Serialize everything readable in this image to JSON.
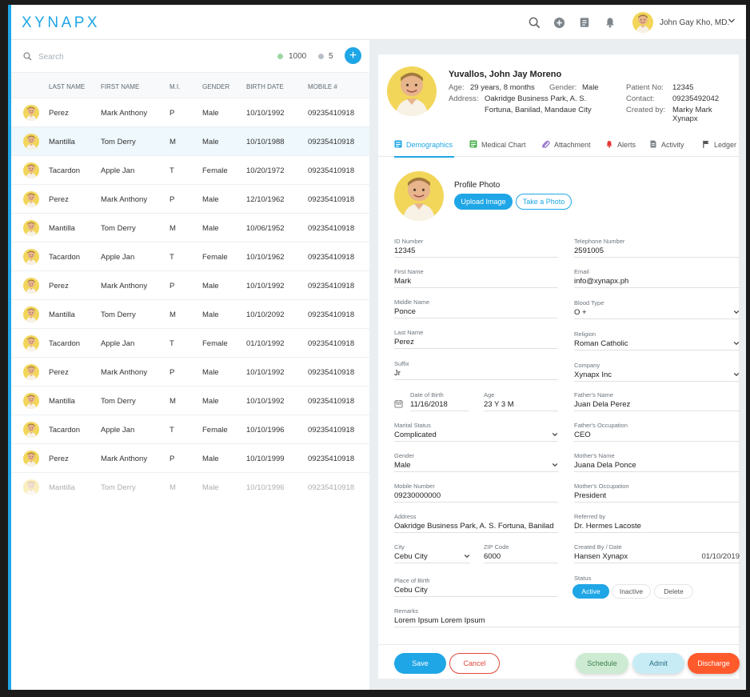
{
  "brand": {
    "logo": "XYNAPX",
    "accent_color": "#1fa6e6"
  },
  "topbar": {
    "icons": [
      "search-icon",
      "add-circle-icon",
      "notes-icon",
      "bell-icon"
    ],
    "user_name": "John Gay Kho, MD."
  },
  "patient_list": {
    "search_placeholder": "Search",
    "counts": [
      {
        "value": "1000",
        "color": "#9bd6a4"
      },
      {
        "value": "5",
        "color": "#b9c0c6"
      }
    ],
    "add_label": "+",
    "columns": [
      "LAST NAME",
      "FIRST NAME",
      "M.I.",
      "GENDER",
      "BIRTH DATE",
      "MOBILE #"
    ],
    "rows": [
      {
        "last": "Perez",
        "first": "Mark Anthony",
        "mi": "P",
        "gender": "Male",
        "birth": "10/10/1992",
        "mobile": "09235410918"
      },
      {
        "last": "Mantilla",
        "first": "Tom Derry",
        "mi": "M",
        "gender": "Male",
        "birth": "10/10/1988",
        "mobile": "09235410918",
        "selected": true
      },
      {
        "last": "Tacardon",
        "first": "Apple Jan",
        "mi": "T",
        "gender": "Female",
        "birth": "10/20/1972",
        "mobile": "09235410918"
      },
      {
        "last": "Perez",
        "first": "Mark Anthony",
        "mi": "P",
        "gender": "Male",
        "birth": "12/10/1962",
        "mobile": "09235410918"
      },
      {
        "last": "Mantilla",
        "first": "Tom Derry",
        "mi": "M",
        "gender": "Male",
        "birth": "10/06/1952",
        "mobile": "09235410918"
      },
      {
        "last": "Tacardon",
        "first": "Apple Jan",
        "mi": "T",
        "gender": "Female",
        "birth": "10/10/1962",
        "mobile": "09235410918"
      },
      {
        "last": "Perez",
        "first": "Mark Anthony",
        "mi": "P",
        "gender": "Male",
        "birth": "10/10/1992",
        "mobile": "09235410918"
      },
      {
        "last": "Mantilla",
        "first": "Tom Derry",
        "mi": "M",
        "gender": "Male",
        "birth": "10/10/2092",
        "mobile": "09235410918"
      },
      {
        "last": "Tacardon",
        "first": "Apple Jan",
        "mi": "T",
        "gender": "Female",
        "birth": "01/10/1992",
        "mobile": "09235410918"
      },
      {
        "last": "Perez",
        "first": "Mark Anthony",
        "mi": "P",
        "gender": "Male",
        "birth": "10/10/1992",
        "mobile": "09235410918"
      },
      {
        "last": "Mantilla",
        "first": "Tom Derry",
        "mi": "M",
        "gender": "Male",
        "birth": "10/10/1992",
        "mobile": "09235410918"
      },
      {
        "last": "Tacardon",
        "first": "Apple Jan",
        "mi": "T",
        "gender": "Female",
        "birth": "10/10/1996",
        "mobile": "09235410918"
      },
      {
        "last": "Perez",
        "first": "Mark Anthony",
        "mi": "P",
        "gender": "Male",
        "birth": "10/10/1999",
        "mobile": "09235410918"
      },
      {
        "last": "Mantilla",
        "first": "Tom Derry",
        "mi": "M",
        "gender": "Male",
        "birth": "10/10/1996",
        "mobile": "09235410918",
        "faded": true
      }
    ]
  },
  "profile": {
    "name": "Yuvallos, John Jay Moreno",
    "age_label": "Age:",
    "age": "29 years, 8 months",
    "gender_label": "Gender:",
    "gender": "Male",
    "address_label": "Address:",
    "address_line1": "Oakridge Business Park, A. S.",
    "address_line2": "Fortuna, Banilad, Mandaue City",
    "patient_no_label": "Patient No:",
    "patient_no": "12345",
    "contact_label": "Contact:",
    "contact": "09235492042",
    "created_by_label": "Created by:",
    "created_by": "Marky Mark Xynapx"
  },
  "tabs": [
    {
      "label": "Demographics",
      "icon": "id-card-icon"
    },
    {
      "label": "Medical Chart",
      "icon": "chart-icon"
    },
    {
      "label": "Attachment",
      "icon": "paperclip-icon"
    },
    {
      "label": "Alerts",
      "icon": "bell-icon"
    },
    {
      "label": "Activity",
      "icon": "document-icon"
    },
    {
      "label": "Ledger",
      "icon": "flag-icon"
    }
  ],
  "photo": {
    "label": "Profile Photo",
    "upload": "Upload Image",
    "take": "Take a Photo"
  },
  "form": {
    "id_number": {
      "label": "ID Number",
      "value": "12345"
    },
    "first_name": {
      "label": "First Name",
      "value": "Mark"
    },
    "middle_name": {
      "label": "Middle Name",
      "value": "Ponce"
    },
    "last_name": {
      "label": "Last Name",
      "value": "Perez"
    },
    "suffix": {
      "label": "Suffix",
      "value": "Jr"
    },
    "dob": {
      "label": "Date of Birth",
      "value": "11/16/2018"
    },
    "age": {
      "label": "Age",
      "value": "23 Y 3 M"
    },
    "marital": {
      "label": "Marital Status",
      "value": "Complicated"
    },
    "gender": {
      "label": "Gender",
      "value": "Male"
    },
    "mobile": {
      "label": "Mobile Number",
      "value": "09230000000"
    },
    "address": {
      "label": "Address",
      "value": "Oakridge Business Park, A. S. Fortuna, Banilad"
    },
    "city": {
      "label": "City",
      "value": "Cebu City"
    },
    "zip": {
      "label": "ZIP Code",
      "value": "6000"
    },
    "birthplace": {
      "label": "Place of Birth",
      "value": "Cebu City"
    },
    "remarks": {
      "label": "Remarks",
      "value": "Lorem Ipsum Lorem Ipsum"
    },
    "telephone": {
      "label": "Telephone Number",
      "value": "2591005"
    },
    "email": {
      "label": "Email",
      "value": "info@xynapx.ph"
    },
    "blood": {
      "label": "Blood Type",
      "value": "O +"
    },
    "religion": {
      "label": "Religion",
      "value": "Roman Catholic"
    },
    "company": {
      "label": "Company",
      "value": "Xynapx Inc"
    },
    "father": {
      "label": "Father's Name",
      "value": "Juan Dela Perez"
    },
    "father_occ": {
      "label": "Father's Occupation",
      "value": "CEO"
    },
    "mother": {
      "label": "Mother's Name",
      "value": "Juana Dela Ponce"
    },
    "mother_occ": {
      "label": "Mother's Occupation",
      "value": "President"
    },
    "referred": {
      "label": "Referred by",
      "value": "Dr. Hermes Lacoste"
    },
    "created": {
      "label": "Created By / Date",
      "value": "Hansen Xynapx",
      "date": "01/10/2019"
    },
    "status": {
      "label": "Status",
      "options": [
        "Active",
        "Inactive",
        "Delete"
      ],
      "selected": "Active"
    }
  },
  "actions": {
    "save": "Save",
    "cancel": "Cancel",
    "schedule": "Schedule",
    "admit": "Admit",
    "discharge": "Discharge"
  }
}
